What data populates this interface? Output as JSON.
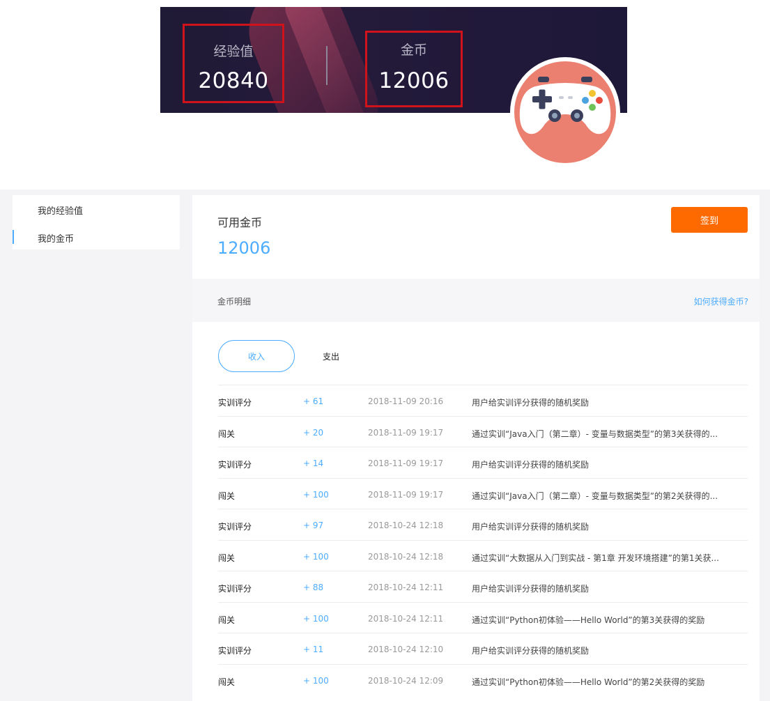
{
  "banner": {
    "exp_label": "经验值",
    "exp_value": "20840",
    "coin_label": "金币",
    "coin_value": "12006"
  },
  "sidebar": {
    "items": [
      {
        "label": "我的经验值"
      },
      {
        "label": "我的金币"
      }
    ]
  },
  "balance": {
    "label": "可用金币",
    "value": "12006",
    "checkin_label": "签到"
  },
  "details": {
    "title": "金币明细",
    "help_link": "如何获得金币?"
  },
  "tabs": {
    "income": "收入",
    "expense": "支出"
  },
  "colors": {
    "accent": "#4cacff",
    "checkin": "#ff6a00",
    "highlight_border": "#d0121b",
    "avatar_bg": "#ec8070"
  },
  "rows": [
    {
      "type": "实训评分",
      "amount": "+ 61",
      "time": "2018-11-09 20:16",
      "desc": "用户给实训评分获得的随机奖励"
    },
    {
      "type": "闯关",
      "amount": "+ 20",
      "time": "2018-11-09 19:17",
      "desc": "通过实训“Java入门（第二章）- 变量与数据类型”的第3关获得的..."
    },
    {
      "type": "实训评分",
      "amount": "+ 14",
      "time": "2018-11-09 19:17",
      "desc": "用户给实训评分获得的随机奖励"
    },
    {
      "type": "闯关",
      "amount": "+ 100",
      "time": "2018-11-09 19:17",
      "desc": "通过实训“Java入门（第二章）- 变量与数据类型”的第2关获得的..."
    },
    {
      "type": "实训评分",
      "amount": "+ 97",
      "time": "2018-10-24 12:18",
      "desc": "用户给实训评分获得的随机奖励"
    },
    {
      "type": "闯关",
      "amount": "+ 100",
      "time": "2018-10-24 12:18",
      "desc": "通过实训“大数据从入门到实战 - 第1章 开发环境搭建”的第1关获..."
    },
    {
      "type": "实训评分",
      "amount": "+ 88",
      "time": "2018-10-24 12:11",
      "desc": "用户给实训评分获得的随机奖励"
    },
    {
      "type": "闯关",
      "amount": "+ 100",
      "time": "2018-10-24 12:11",
      "desc": "通过实训“Python初体验——Hello World”的第3关获得的奖励"
    },
    {
      "type": "实训评分",
      "amount": "+ 11",
      "time": "2018-10-24 12:10",
      "desc": "用户给实训评分获得的随机奖励"
    },
    {
      "type": "闯关",
      "amount": "+ 100",
      "time": "2018-10-24 12:09",
      "desc": "通过实训“Python初体验——Hello World”的第2关获得的奖励"
    }
  ]
}
